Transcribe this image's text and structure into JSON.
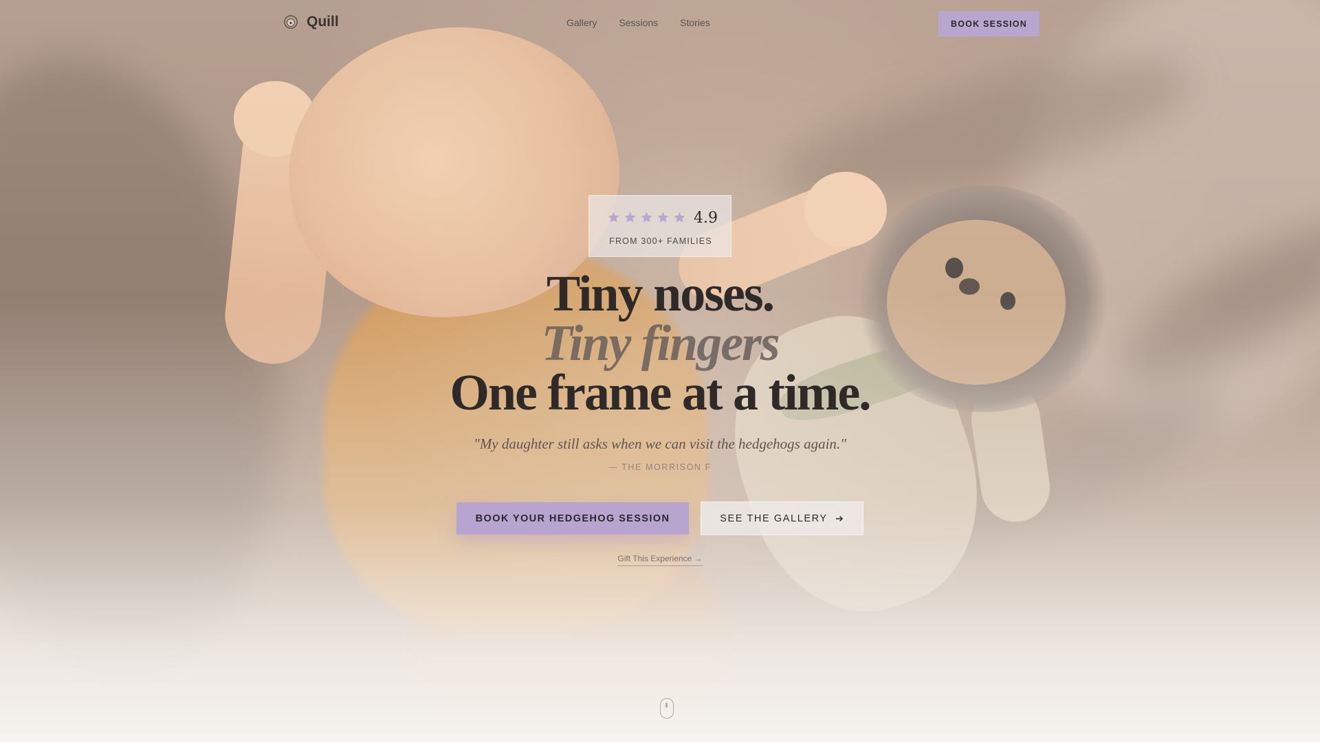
{
  "nav": {
    "brand": "Quill",
    "links": [
      "Gallery",
      "Sessions",
      "Stories"
    ],
    "cta": "BOOK SESSION"
  },
  "rating": {
    "stars": 5,
    "value": "4.9",
    "caption": "FROM 300+ FAMILIES"
  },
  "headline": {
    "line1": "Tiny noses.",
    "line2": "Tiny fingers",
    "line3": "One frame at a time."
  },
  "testimonial": {
    "quote": "\"My daughter still asks when we can visit the hedgehogs again.\"",
    "attribution": "— THE MORRISON F"
  },
  "actions": {
    "primary": "BOOK YOUR HEDGEHOG SESSION",
    "secondary": "SEE THE GALLERY",
    "gift_icon": "",
    "gift": "Gift This Experience →"
  },
  "colors": {
    "accent": "#b8a6cf",
    "text": "#2f2a27",
    "background": "#f4f0ec"
  },
  "icons": {
    "brand": "hedgehog-logo-icon",
    "star": "star-icon",
    "arrow": "arrow-right-icon",
    "scroll": "mouse-scroll-icon"
  }
}
